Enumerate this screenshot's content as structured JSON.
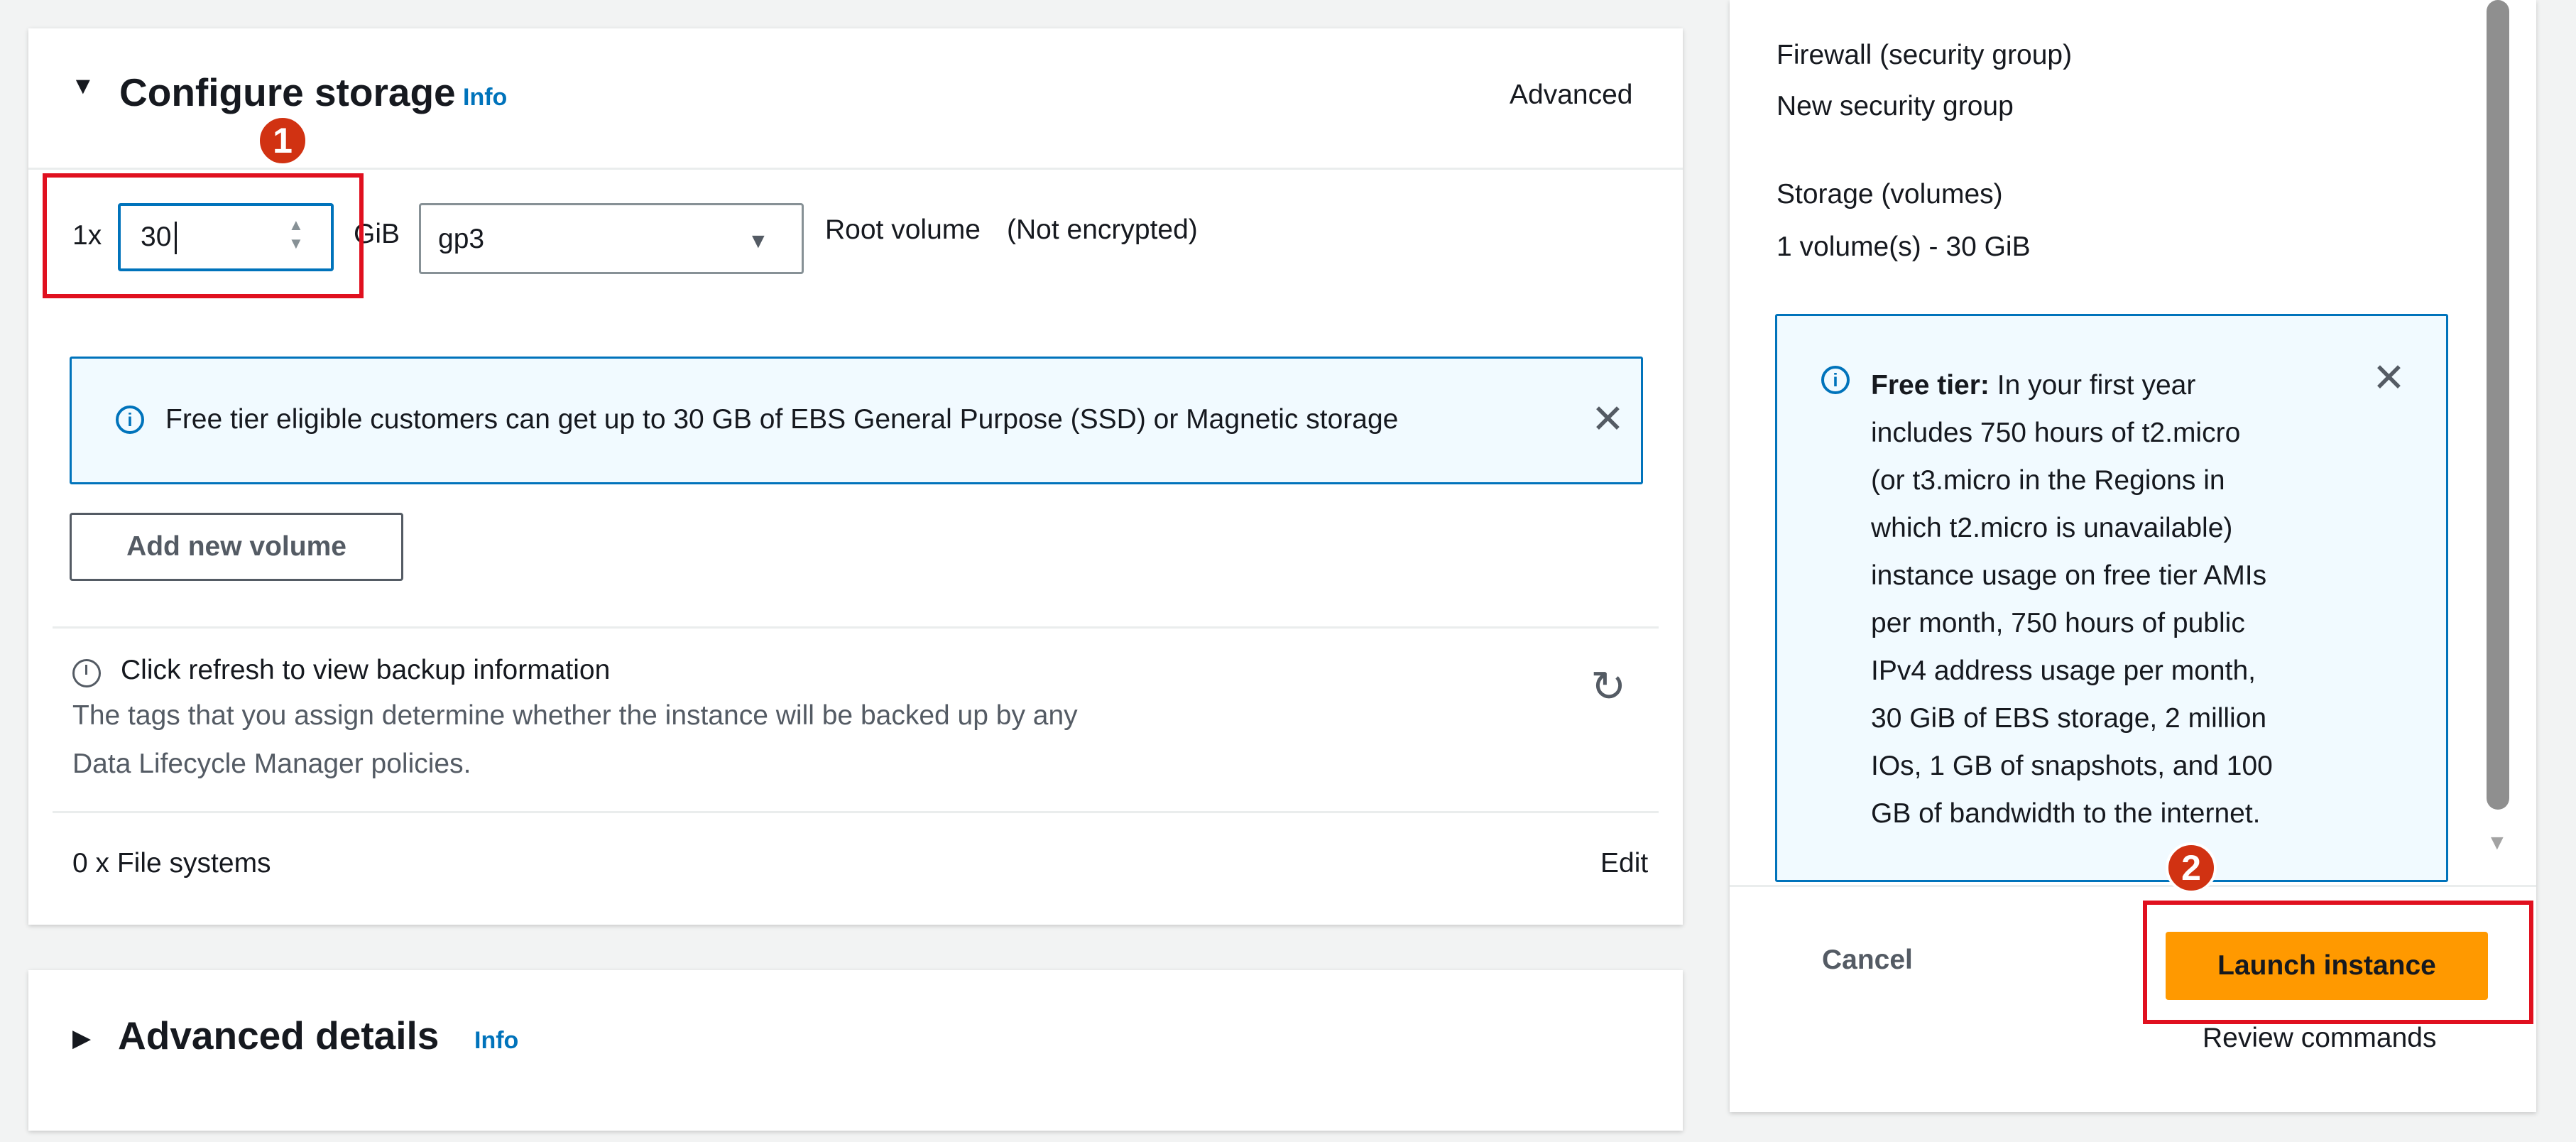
{
  "storage": {
    "title": "Configure storage",
    "info": "Info",
    "advanced_link": "Advanced",
    "volume_count": "1x",
    "size_value": "30",
    "unit": "GiB",
    "volume_type": "gp3",
    "root_label": "Root volume",
    "encryption": "(Not encrypted)",
    "free_tier_alert": "Free tier eligible customers can get up to 30 GB of EBS General Purpose (SSD) or Magnetic storage",
    "add_volume_button": "Add new volume",
    "backup_title": "Click refresh to view backup information",
    "backup_desc_line1": "The tags that you assign determine whether the instance will be backed up by any",
    "backup_desc_line2": "Data Lifecycle Manager policies.",
    "file_systems": "0 x File systems",
    "edit_link": "Edit"
  },
  "advanced_details": {
    "title": "Advanced details",
    "info": "Info"
  },
  "summary": {
    "firewall_label": "Firewall (security group)",
    "firewall_value": "New security group",
    "storage_label": "Storage (volumes)",
    "storage_value": "1 volume(s) - 30 GiB",
    "free_tier_title": "Free tier:",
    "free_tier_lines": [
      "In your first year",
      "includes 750 hours of t2.micro",
      "(or t3.micro in the Regions in",
      "which t2.micro is unavailable)",
      "instance usage on free tier AMIs",
      "per month, 750 hours of public",
      "IPv4 address usage per month,",
      "30 GiB of EBS storage, 2 million",
      "IOs, 1 GB of snapshots, and 100",
      "GB of bandwidth to the internet."
    ],
    "cancel_button": "Cancel",
    "launch_button": "Launch instance",
    "review_link": "Review commands"
  },
  "annotations": {
    "badge_1": "1",
    "badge_2": "2"
  },
  "colors": {
    "link": "#0073bb",
    "primary_button": "#ff9900",
    "annotation_red": "#e0101f",
    "alert_border": "#0073bb",
    "alert_bg": "#f1faff"
  }
}
